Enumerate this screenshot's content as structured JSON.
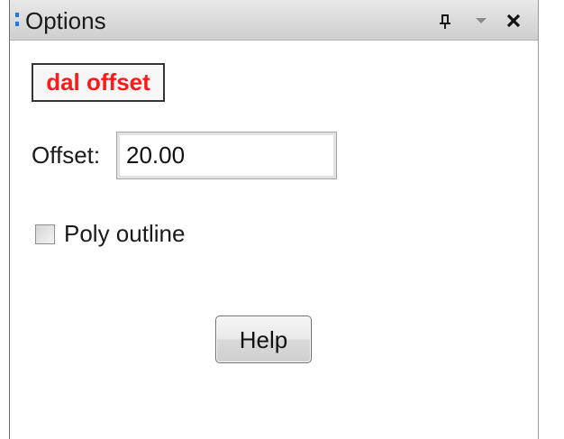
{
  "panel": {
    "title": "Options",
    "controls": {
      "pin": "pin-icon",
      "dropdown": "chevron-down-icon",
      "close": "close-icon"
    }
  },
  "mode": {
    "label": "dal offset",
    "color": "#ff1a1a"
  },
  "offset": {
    "label": "Offset:",
    "value": "20.00"
  },
  "poly_outline": {
    "label": "Poly outline",
    "checked": false
  },
  "help": {
    "label": "Help"
  }
}
